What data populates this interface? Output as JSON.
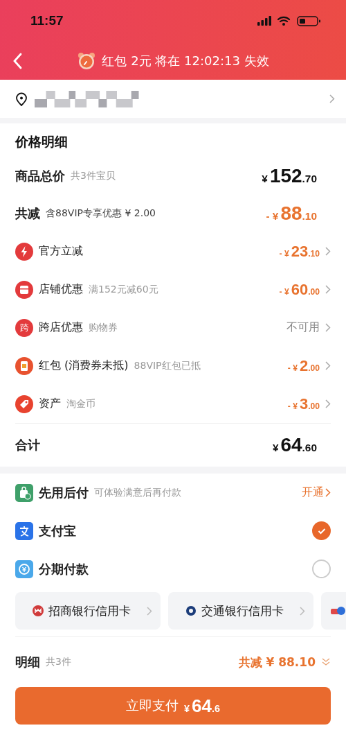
{
  "status_bar": {
    "time": "11:57"
  },
  "nav": {
    "notice_parts": [
      "红包 2元",
      "将在",
      "12:02:13",
      "失效"
    ]
  },
  "price_details": {
    "title": "价格明细",
    "subtotal": {
      "label": "商品总价",
      "note": "共3件宝贝",
      "amount": {
        "prefix": "¥",
        "main": "152",
        "cents": ".70"
      }
    },
    "discount_total": {
      "label": "共减",
      "note": "含88VIP专享优惠 ¥ 2.00",
      "amount": {
        "prefix": "- ¥",
        "main": "88",
        "cents": ".10"
      }
    },
    "discounts": [
      {
        "kind": "bolt",
        "label": "官方立减",
        "amount": {
          "prefix": "- ¥",
          "main": "23",
          "cents": ".10"
        }
      },
      {
        "kind": "store",
        "label": "店铺优惠",
        "note": "满152元减60元",
        "amount": {
          "prefix": "- ¥",
          "main": "60",
          "cents": ".00"
        }
      },
      {
        "kind": "char",
        "icon_text": "跨",
        "label": "跨店优惠",
        "note": "购物券",
        "value": "不可用"
      },
      {
        "kind": "packet",
        "label": "红包 (消费券未抵)",
        "note": "88VIP红包已抵",
        "amount": {
          "prefix": "- ¥",
          "main": "2",
          "cents": ".00"
        }
      },
      {
        "kind": "tag",
        "label": "资产",
        "note": "淘金币",
        "amount": {
          "prefix": "- ¥",
          "main": "3",
          "cents": ".00"
        }
      }
    ],
    "total": {
      "label": "合计",
      "amount": {
        "prefix": "¥",
        "main": "64",
        "cents": ".60"
      }
    }
  },
  "payment_methods": [
    {
      "kind": "link",
      "label": "先用后付",
      "note": "可体验满意后再付款",
      "action": "开通"
    },
    {
      "kind": "radio",
      "label": "支付宝",
      "selected": true
    },
    {
      "kind": "radio",
      "label": "分期付款",
      "selected": false
    }
  ],
  "bank_cards": [
    {
      "kind": "card",
      "label": "招商银行信用卡"
    },
    {
      "kind": "card",
      "label": "交通银行信用卡"
    },
    {
      "kind": "partial"
    }
  ],
  "summary": {
    "label": "明细",
    "count": "共3件",
    "discount": "共减 ¥ 88.10"
  },
  "pay_button": {
    "label": "立即支付",
    "prefix": "¥",
    "main": "64",
    "cents": ".6"
  }
}
